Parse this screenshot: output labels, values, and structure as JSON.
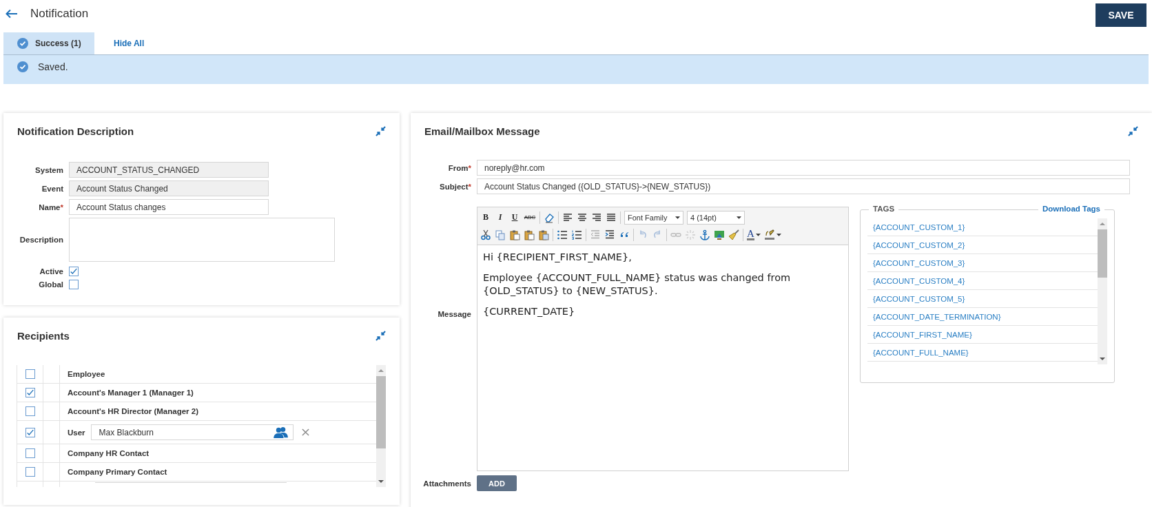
{
  "header": {
    "title": "Notification",
    "save_button": "SAVE"
  },
  "alerts": {
    "tabs": [
      {
        "label": "Success (1)",
        "selected": true
      }
    ],
    "hide_all": "Hide All",
    "message": "Saved."
  },
  "description_panel": {
    "title": "Notification Description",
    "fields": [
      {
        "label": "System",
        "value": "ACCOUNT_STATUS_CHANGED",
        "disabled": true
      },
      {
        "label": "Event",
        "value": "Account Status Changed",
        "disabled": true
      },
      {
        "label": "Name",
        "required_mark": "*",
        "value": "Account Status changes",
        "disabled": false
      }
    ],
    "description_label": "Description",
    "checkboxes": [
      {
        "label": "Active",
        "checked": true
      },
      {
        "label": "Global",
        "checked": false
      }
    ]
  },
  "recipients_panel": {
    "title": "Recipients",
    "rows": [
      {
        "kind": "label",
        "name": "Employee",
        "checked": false
      },
      {
        "kind": "label",
        "name": "Account's Manager 1 (Manager 1)",
        "checked": true
      },
      {
        "kind": "label",
        "name": "Account's HR Director (Manager 2)",
        "checked": false
      },
      {
        "kind": "user",
        "name": "User",
        "value": "Max Blackburn",
        "checked": true
      },
      {
        "kind": "label",
        "name": "Company HR Contact",
        "checked": false
      },
      {
        "kind": "label",
        "name": "Company Primary Contact",
        "checked": false
      }
    ]
  },
  "message_panel": {
    "title": "Email/Mailbox Message",
    "from": {
      "label": "From",
      "required_mark": "*",
      "value": "noreply@hr.com"
    },
    "subject": {
      "label": "Subject",
      "required_mark": "*",
      "value": "Account Status Changed ({OLD_STATUS}->{NEW_STATUS})"
    },
    "message_label": "Message",
    "toolbar": {
      "format_buttons": [
        "B",
        "I",
        "U",
        "ABC"
      ],
      "font_family": "Font Family",
      "font_size": "4 (14pt)",
      "text_color": "A"
    },
    "body": [
      "Hi {RECIPIENT_FIRST_NAME},",
      "Employee {ACCOUNT_FULL_NAME} status was changed from {OLD_STATUS} to {NEW_STATUS}.",
      "{CURRENT_DATE}"
    ],
    "tags": {
      "title": "TAGS",
      "download": "Download Tags",
      "items": [
        "{ACCOUNT_CUSTOM_1}",
        "{ACCOUNT_CUSTOM_2}",
        "{ACCOUNT_CUSTOM_3}",
        "{ACCOUNT_CUSTOM_4}",
        "{ACCOUNT_CUSTOM_5}",
        "{ACCOUNT_DATE_TERMINATION}",
        "{ACCOUNT_FIRST_NAME}",
        "{ACCOUNT_FULL_NAME}"
      ]
    },
    "attachments_label": "Attachments",
    "add_button": "ADD"
  }
}
